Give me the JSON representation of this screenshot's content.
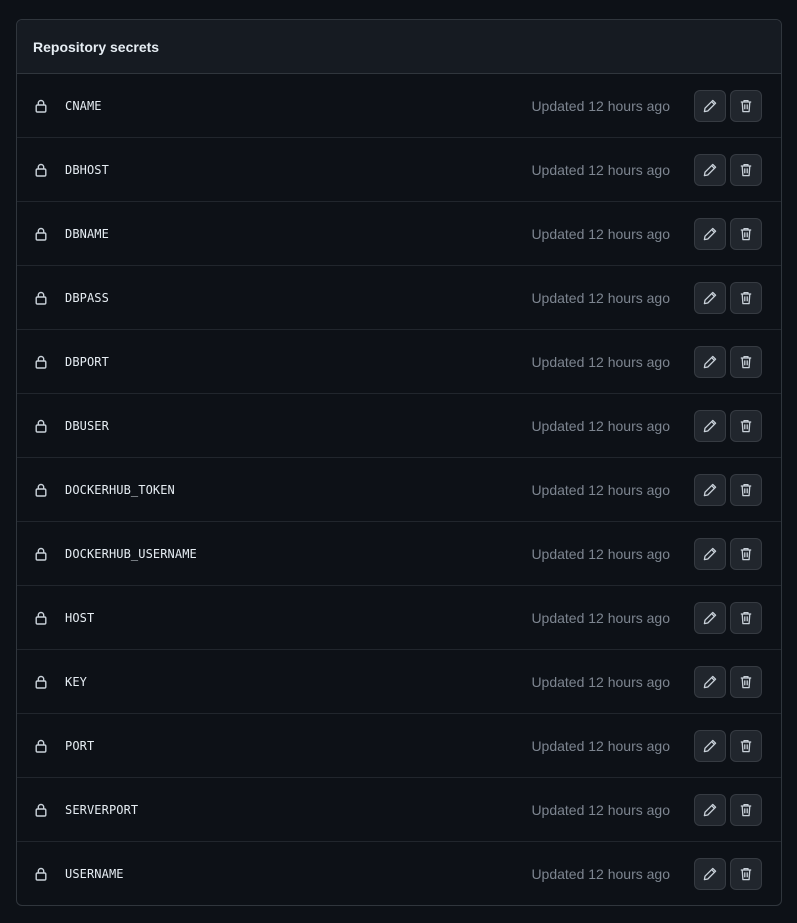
{
  "panel": {
    "title": "Repository secrets"
  },
  "secrets": [
    {
      "name": "CNAME",
      "updated": "Updated 12 hours ago"
    },
    {
      "name": "DBHOST",
      "updated": "Updated 12 hours ago"
    },
    {
      "name": "DBNAME",
      "updated": "Updated 12 hours ago"
    },
    {
      "name": "DBPASS",
      "updated": "Updated 12 hours ago"
    },
    {
      "name": "DBPORT",
      "updated": "Updated 12 hours ago"
    },
    {
      "name": "DBUSER",
      "updated": "Updated 12 hours ago"
    },
    {
      "name": "DOCKERHUB_TOKEN",
      "updated": "Updated 12 hours ago"
    },
    {
      "name": "DOCKERHUB_USERNAME",
      "updated": "Updated 12 hours ago"
    },
    {
      "name": "HOST",
      "updated": "Updated 12 hours ago"
    },
    {
      "name": "KEY",
      "updated": "Updated 12 hours ago"
    },
    {
      "name": "PORT",
      "updated": "Updated 12 hours ago"
    },
    {
      "name": "SERVERPORT",
      "updated": "Updated 12 hours ago"
    },
    {
      "name": "USERNAME",
      "updated": "Updated 12 hours ago"
    }
  ],
  "icons": {
    "row_icon": "lock-icon",
    "edit": "pencil-icon",
    "delete": "trash-icon"
  },
  "colors": {
    "background": "#0d1117",
    "header_background": "#161b22",
    "border": "#30363d",
    "button_background": "#21262d",
    "muted_text": "#7d8590"
  }
}
